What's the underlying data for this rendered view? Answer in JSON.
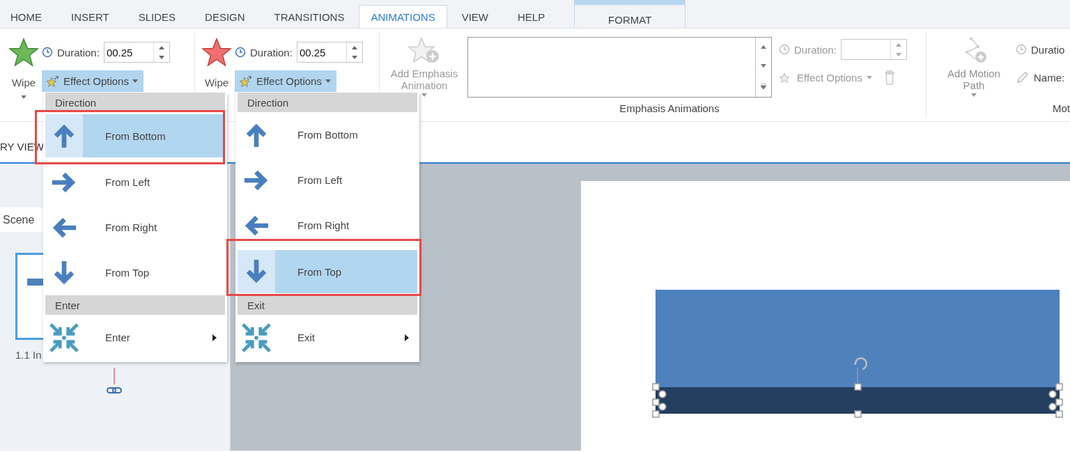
{
  "tabs": [
    {
      "label": "HOME",
      "selected": false,
      "kind": "normal"
    },
    {
      "label": "INSERT",
      "selected": false,
      "kind": "normal"
    },
    {
      "label": "SLIDES",
      "selected": false,
      "kind": "normal"
    },
    {
      "label": "DESIGN",
      "selected": false,
      "kind": "normal"
    },
    {
      "label": "TRANSITIONS",
      "selected": false,
      "kind": "normal"
    },
    {
      "label": "ANIMATIONS",
      "selected": true,
      "kind": "normal"
    },
    {
      "label": "VIEW",
      "selected": false,
      "kind": "normal"
    },
    {
      "label": "HELP",
      "selected": false,
      "kind": "normal"
    },
    {
      "label": "FORMAT",
      "selected": false,
      "kind": "contextual"
    }
  ],
  "ribbon": {
    "effect_groups": [
      {
        "kind": "entrance",
        "effect": "Wipe",
        "duration_label": "Duration:",
        "duration": "00.25",
        "effect_options": "Effect Options",
        "options_open": true
      },
      {
        "kind": "exit",
        "effect": "Wipe",
        "duration_label": "Duration:",
        "duration": "00.25",
        "effect_options": "Effect Options",
        "options_open": true
      }
    ],
    "emphasis": {
      "add_button": [
        "Add Emphasis",
        "Animation"
      ],
      "duration_label": "Duration:",
      "effect_options": "Effect Options",
      "group_label": "Emphasis Animations",
      "disabled": true
    },
    "motion": {
      "add_button": [
        "Add Motion",
        "Path"
      ],
      "duration_label": "Duratio",
      "name_label": "Name:",
      "group_label": "Mot"
    }
  },
  "view_label": "RY VIEW",
  "scene_tab": "Scene",
  "thumbnail_caption": "1.1 In",
  "menus": [
    {
      "sections": [
        {
          "header": "Direction",
          "items": [
            {
              "label": "From Bottom",
              "kind": "direction",
              "selected": true
            },
            {
              "label": "From Left",
              "kind": "direction",
              "selected": false
            },
            {
              "label": "From Right",
              "kind": "direction",
              "selected": false
            },
            {
              "label": "From Top",
              "kind": "direction",
              "selected": false
            }
          ]
        },
        {
          "header": "Enter",
          "items": [
            {
              "label": "Enter",
              "kind": "submenu",
              "selected": false
            }
          ]
        }
      ]
    },
    {
      "sections": [
        {
          "header": "Direction",
          "items": [
            {
              "label": "From Bottom",
              "kind": "direction",
              "selected": false
            },
            {
              "label": "From Left",
              "kind": "direction",
              "selected": false
            },
            {
              "label": "From Right",
              "kind": "direction",
              "selected": false
            },
            {
              "label": "From Top",
              "kind": "direction",
              "selected": true
            }
          ]
        },
        {
          "header": "Exit",
          "items": [
            {
              "label": "Exit",
              "kind": "submenu",
              "selected": false
            }
          ]
        }
      ]
    }
  ]
}
